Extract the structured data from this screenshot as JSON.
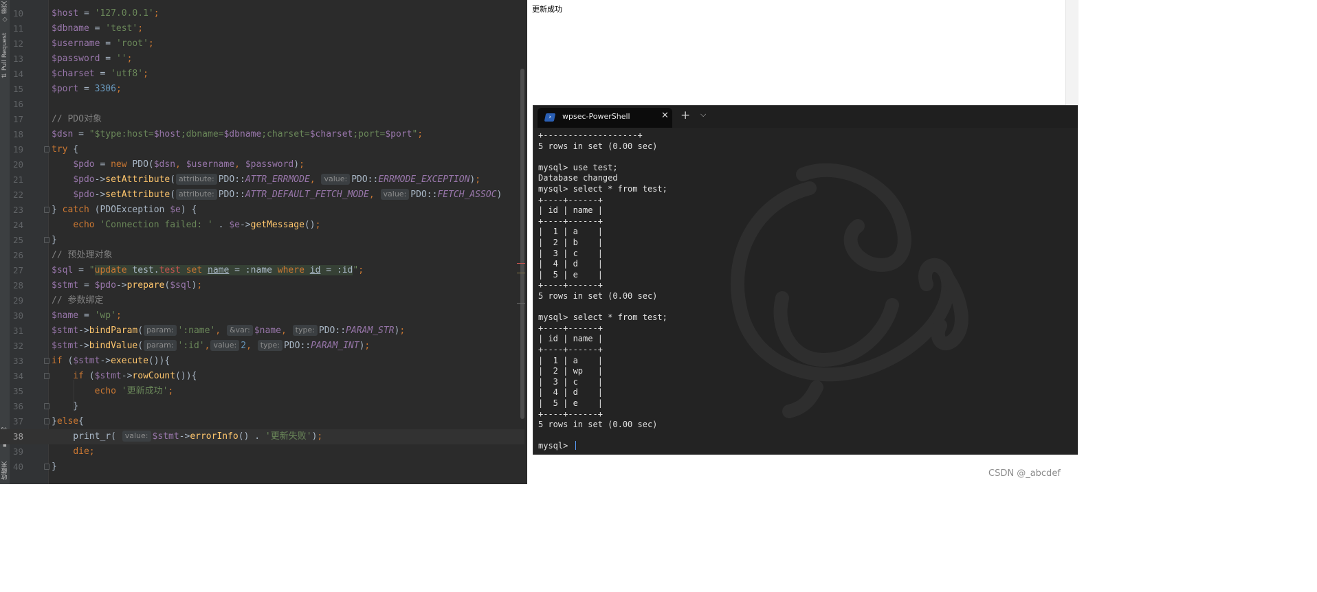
{
  "ide": {
    "side_labels": {
      "top": "提交",
      "pull_request": "Pull Request",
      "structure": "结构",
      "favorites": "收藏夹"
    },
    "lines": [
      {
        "num": "10",
        "segs": [
          [
            "v",
            "$host"
          ],
          [
            "o",
            " = "
          ],
          [
            "s",
            "'127.0.0.1'"
          ],
          [
            "k",
            ";"
          ]
        ]
      },
      {
        "num": "11",
        "segs": [
          [
            "v",
            "$dbname"
          ],
          [
            "o",
            " = "
          ],
          [
            "s",
            "'test'"
          ],
          [
            "k",
            ";"
          ]
        ]
      },
      {
        "num": "12",
        "segs": [
          [
            "v",
            "$username"
          ],
          [
            "o",
            " = "
          ],
          [
            "s",
            "'root'"
          ],
          [
            "k",
            ";"
          ]
        ]
      },
      {
        "num": "13",
        "segs": [
          [
            "v",
            "$password"
          ],
          [
            "o",
            " = "
          ],
          [
            "s",
            "''"
          ],
          [
            "k",
            ";"
          ]
        ]
      },
      {
        "num": "14",
        "segs": [
          [
            "v",
            "$charset"
          ],
          [
            "o",
            " = "
          ],
          [
            "s",
            "'utf8'"
          ],
          [
            "k",
            ";"
          ]
        ]
      },
      {
        "num": "15",
        "segs": [
          [
            "v",
            "$port"
          ],
          [
            "o",
            " = "
          ],
          [
            "n",
            "3306"
          ],
          [
            "k",
            ";"
          ]
        ]
      },
      {
        "num": "16",
        "segs": []
      },
      {
        "num": "17",
        "segs": [
          [
            "c",
            "// PDO对象"
          ]
        ]
      },
      {
        "num": "18",
        "segs": [
          [
            "v",
            "$dsn"
          ],
          [
            "o",
            " = "
          ],
          [
            "s",
            "\"$type:host="
          ],
          [
            "v",
            "$host"
          ],
          [
            "s",
            ";dbname="
          ],
          [
            "v",
            "$dbname"
          ],
          [
            "s",
            ";charset="
          ],
          [
            "v",
            "$charset"
          ],
          [
            "s",
            ";port="
          ],
          [
            "v",
            "$port"
          ],
          [
            "s",
            "\""
          ],
          [
            "k",
            ";"
          ]
        ]
      },
      {
        "num": "19",
        "fold": true,
        "segs": [
          [
            "k",
            "try"
          ],
          [
            "o",
            " {"
          ]
        ]
      },
      {
        "num": "20",
        "segs": [
          [
            "o",
            "    "
          ],
          [
            "v",
            "$pdo"
          ],
          [
            "o",
            " = "
          ],
          [
            "k",
            "new "
          ],
          [
            "cls",
            "PDO("
          ],
          [
            "v",
            "$dsn"
          ],
          [
            "k",
            ", "
          ],
          [
            "v",
            "$username"
          ],
          [
            "k",
            ", "
          ],
          [
            "v",
            "$password"
          ],
          [
            "o",
            ")"
          ],
          [
            "k",
            ";"
          ]
        ]
      },
      {
        "num": "21",
        "segs": [
          [
            "o",
            "    "
          ],
          [
            "v",
            "$pdo"
          ],
          [
            "o",
            "->"
          ],
          [
            "f",
            "setAttribute"
          ],
          [
            "o",
            "("
          ],
          [
            "h",
            "attribute:"
          ],
          [
            "cls",
            "PDO::"
          ],
          [
            "ci",
            "ATTR_ERRMODE"
          ],
          [
            "k",
            ", "
          ],
          [
            "h",
            "value:"
          ],
          [
            "cls",
            "PDO::"
          ],
          [
            "ci",
            "ERRMODE_EXCEPTION"
          ],
          [
            "o",
            ")"
          ],
          [
            "k",
            ";"
          ]
        ]
      },
      {
        "num": "22",
        "segs": [
          [
            "o",
            "    "
          ],
          [
            "v",
            "$pdo"
          ],
          [
            "o",
            "->"
          ],
          [
            "f",
            "setAttribute"
          ],
          [
            "o",
            "("
          ],
          [
            "h",
            "attribute:"
          ],
          [
            "cls",
            "PDO::"
          ],
          [
            "ci",
            "ATTR_DEFAULT_FETCH_MODE"
          ],
          [
            "k",
            ", "
          ],
          [
            "h",
            "value:"
          ],
          [
            "cls",
            "PDO::"
          ],
          [
            "ci",
            "FETCH_ASSOC"
          ],
          [
            "o",
            ")"
          ]
        ]
      },
      {
        "num": "23",
        "fold": true,
        "segs": [
          [
            "o",
            "} "
          ],
          [
            "k",
            "catch"
          ],
          [
            "o",
            " ("
          ],
          [
            "cls",
            "PDOException "
          ],
          [
            "v",
            "$e"
          ],
          [
            "o",
            ") {"
          ]
        ]
      },
      {
        "num": "24",
        "segs": [
          [
            "o",
            "    "
          ],
          [
            "k",
            "echo "
          ],
          [
            "s",
            "'Connection failed: '"
          ],
          [
            "o",
            " . "
          ],
          [
            "v",
            "$e"
          ],
          [
            "o",
            "->"
          ],
          [
            "f",
            "getMessage"
          ],
          [
            "o",
            "()"
          ],
          [
            "k",
            ";"
          ]
        ]
      },
      {
        "num": "25",
        "fold": true,
        "segs": [
          [
            "o",
            "}"
          ]
        ]
      },
      {
        "num": "26",
        "segs": [
          [
            "c",
            "// 预处理对象"
          ]
        ]
      },
      {
        "num": "27",
        "segs": [
          [
            "v",
            "$sql"
          ],
          [
            "o",
            " = "
          ],
          [
            "s",
            "\""
          ],
          [
            "sqlk",
            "update"
          ],
          [
            "o",
            " test."
          ],
          [
            "sqlt",
            "test"
          ],
          [
            "sqlk",
            " set "
          ],
          [
            "sqlid",
            "name"
          ],
          [
            "o",
            " = :name "
          ],
          [
            "sqlk",
            "where "
          ],
          [
            "sqlid",
            "id"
          ],
          [
            "o",
            " = :id"
          ],
          [
            "s",
            "\""
          ],
          [
            "k",
            ";"
          ]
        ]
      },
      {
        "num": "28",
        "segs": [
          [
            "v",
            "$stmt"
          ],
          [
            "o",
            " = "
          ],
          [
            "v",
            "$pdo"
          ],
          [
            "o",
            "->"
          ],
          [
            "f",
            "prepare"
          ],
          [
            "o",
            "("
          ],
          [
            "v",
            "$sql"
          ],
          [
            "o",
            ")"
          ],
          [
            "k",
            ";"
          ]
        ]
      },
      {
        "num": "29",
        "segs": [
          [
            "c",
            "// 参数绑定"
          ]
        ]
      },
      {
        "num": "30",
        "segs": [
          [
            "v",
            "$name"
          ],
          [
            "o",
            " = "
          ],
          [
            "s",
            "'wp'"
          ],
          [
            "k",
            ";"
          ]
        ]
      },
      {
        "num": "31",
        "segs": [
          [
            "v",
            "$stmt"
          ],
          [
            "o",
            "->"
          ],
          [
            "f",
            "bindParam"
          ],
          [
            "o",
            "("
          ],
          [
            "h",
            "param:"
          ],
          [
            "s",
            "':name'"
          ],
          [
            "k",
            ", "
          ],
          [
            "h",
            "&var:"
          ],
          [
            "v",
            "$name"
          ],
          [
            "k",
            ", "
          ],
          [
            "h",
            "type:"
          ],
          [
            "cls",
            "PDO::"
          ],
          [
            "ci",
            "PARAM_STR"
          ],
          [
            "o",
            ")"
          ],
          [
            "k",
            ";"
          ]
        ]
      },
      {
        "num": "32",
        "segs": [
          [
            "v",
            "$stmt"
          ],
          [
            "o",
            "->"
          ],
          [
            "f",
            "bindValue"
          ],
          [
            "o",
            "("
          ],
          [
            "h",
            "param:"
          ],
          [
            "s",
            "':id'"
          ],
          [
            "k",
            ","
          ],
          [
            "h",
            "value:"
          ],
          [
            "n",
            "2"
          ],
          [
            "k",
            ", "
          ],
          [
            "h",
            "type:"
          ],
          [
            "cls",
            "PDO::"
          ],
          [
            "ci",
            "PARAM_INT"
          ],
          [
            "o",
            ")"
          ],
          [
            "k",
            ";"
          ]
        ]
      },
      {
        "num": "33",
        "fold": true,
        "segs": [
          [
            "k",
            "if"
          ],
          [
            "o",
            " ("
          ],
          [
            "v",
            "$stmt"
          ],
          [
            "o",
            "->"
          ],
          [
            "f",
            "execute"
          ],
          [
            "o",
            "()){"
          ]
        ]
      },
      {
        "num": "34",
        "fold": true,
        "segs": [
          [
            "o",
            "    "
          ],
          [
            "k",
            "if"
          ],
          [
            "o",
            " ("
          ],
          [
            "v",
            "$stmt"
          ],
          [
            "o",
            "->"
          ],
          [
            "f",
            "rowCount"
          ],
          [
            "o",
            "()){"
          ]
        ]
      },
      {
        "num": "35",
        "segs": [
          [
            "o",
            "        "
          ],
          [
            "k",
            "echo "
          ],
          [
            "s",
            "'更新成功'"
          ],
          [
            "k",
            ";"
          ]
        ]
      },
      {
        "num": "36",
        "fold": true,
        "segs": [
          [
            "o",
            "    }"
          ]
        ]
      },
      {
        "num": "37",
        "fold": true,
        "segs": [
          [
            "o",
            "}"
          ],
          [
            "k",
            "else"
          ],
          [
            "o",
            "{"
          ]
        ]
      },
      {
        "num": "38",
        "current": true,
        "segs": [
          [
            "o",
            "    print_r( "
          ],
          [
            "h",
            "value:"
          ],
          [
            "v",
            "$stmt"
          ],
          [
            "o",
            "->"
          ],
          [
            "f",
            "errorInfo"
          ],
          [
            "o",
            "() . "
          ],
          [
            "s",
            "'更新失败'"
          ],
          [
            "o",
            ")"
          ],
          [
            "k",
            ";"
          ]
        ]
      },
      {
        "num": "39",
        "segs": [
          [
            "o",
            "    "
          ],
          [
            "k",
            "die"
          ],
          [
            "k",
            ";"
          ]
        ]
      },
      {
        "num": "40",
        "fold": true,
        "segs": [
          [
            "o",
            "}"
          ]
        ]
      }
    ],
    "colors": {
      "background": "#2b2b2b",
      "variable": "#9876aa",
      "string": "#6a8759",
      "keyword": "#cc7832",
      "number": "#6897bb",
      "comment": "#808080",
      "function": "#ffc66d"
    }
  },
  "output": {
    "text": "更新成功"
  },
  "terminal": {
    "tab_title": "wpsec-PowerShell",
    "close_glyph": "✕",
    "new_tab_glyph": "+",
    "dropdown_glyph": "⌵",
    "lines": [
      "+-------------------+",
      "5 rows in set (0.00 sec)",
      "",
      "mysql> use test;",
      "Database changed",
      "mysql> select * from test;",
      "+----+------+",
      "| id | name |",
      "+----+------+",
      "|  1 | a    |",
      "|  2 | b    |",
      "|  3 | c    |",
      "|  4 | d    |",
      "|  5 | e    |",
      "+----+------+",
      "5 rows in set (0.00 sec)",
      "",
      "mysql> select * from test;",
      "+----+------+",
      "| id | name |",
      "+----+------+",
      "|  1 | a    |",
      "|  2 | wp   |",
      "|  3 | c    |",
      "|  4 | d    |",
      "|  5 | e    |",
      "+----+------+",
      "5 rows in set (0.00 sec)",
      "",
      "mysql> "
    ]
  },
  "watermark": {
    "text": "CSDN @_abcdef"
  }
}
